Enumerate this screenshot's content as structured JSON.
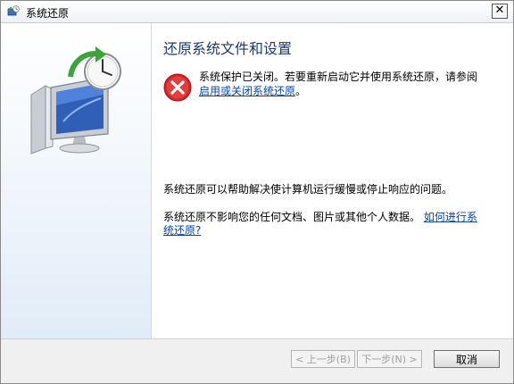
{
  "window": {
    "title": "系统还原",
    "close_glyph": "✕"
  },
  "main": {
    "heading": "还原系统文件和设置",
    "error_message_part1": "系统保护已关闭。若要重新启动它并使用系统还原，请参阅",
    "error_link": "启用或关闭系统还原",
    "error_message_part2": "。",
    "paragraph1": "系统还原可以帮助解决使计算机运行缓慢或停止响应的问题。",
    "paragraph2": "系统还原不影响您的任何文档、图片或其他个人数据。",
    "how_to_link": "如何进行系统还原?"
  },
  "buttons": {
    "prev_label": "< 上一步(B)",
    "next_label": "下一步(N) >",
    "cancel_label": "取消"
  },
  "icons": {
    "title_icon": "system-restore-icon",
    "side_icon": "computer-restore-icon",
    "error_icon": "error-icon"
  },
  "colors": {
    "heading": "#1a3a6b",
    "link": "#0645ad",
    "error_red": "#d42424",
    "restore_green": "#3aa63a"
  }
}
